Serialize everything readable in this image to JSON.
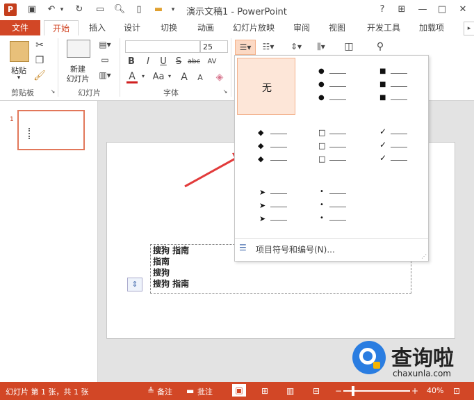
{
  "title_bar": {
    "app_icon": "P",
    "document_title": "演示文稿1 - PowerPoint",
    "help": "?",
    "restore": "⊞",
    "minimize": "—",
    "maximize": "□",
    "close": "✕"
  },
  "tabs": [
    "文件",
    "开始",
    "插入",
    "设计",
    "切换",
    "动画",
    "幻灯片放映",
    "审阅",
    "视图",
    "开发工具",
    "加载项"
  ],
  "ribbon": {
    "clipboard": {
      "paste": "粘贴",
      "label": "剪贴板"
    },
    "slides": {
      "new_slide_line1": "新建",
      "new_slide_line2": "幻灯片",
      "label": "幻灯片"
    },
    "font": {
      "size": "25",
      "label": "字体",
      "bold": "B",
      "italic": "I",
      "underline": "U",
      "strike": "S",
      "shadow": "abc",
      "spacing": "AV",
      "color": "A",
      "case": "Aa",
      "grow": "A",
      "shrink": "A"
    }
  },
  "bullet_menu": {
    "none_label": "无",
    "footer_label": "项目符号和编号(N)..."
  },
  "slide": {
    "number": "1",
    "lines": [
      "搜狗 指南",
      "指南",
      "搜狗",
      "搜狗 指南"
    ]
  },
  "watermark": {
    "name": "查询啦",
    "url": "chaxunla.com"
  },
  "status_bar": {
    "slide_info": "幻灯片 第 1 张，共 1 张",
    "notes": "备注",
    "comments": "批注",
    "zoom": "40%"
  },
  "colors": {
    "accent": "#d24726",
    "selection": "#fde6d8"
  }
}
